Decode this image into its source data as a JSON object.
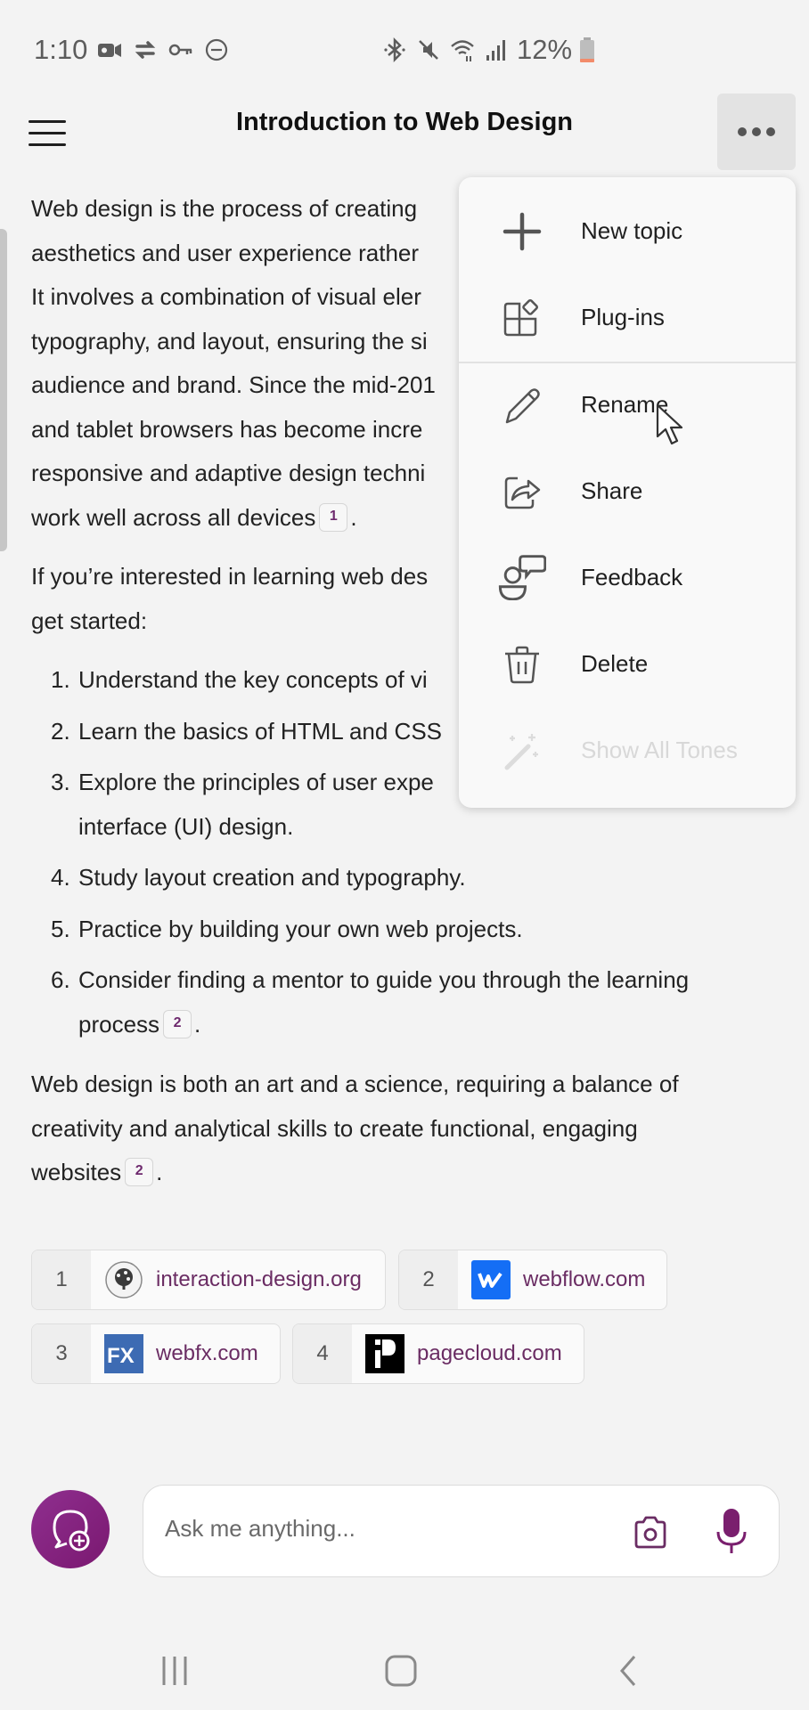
{
  "status_bar": {
    "time": "1:10",
    "left_icons": [
      "video-camera-icon",
      "sync-icon",
      "key-icon",
      "do-not-disturb-icon"
    ],
    "right_icons": [
      "bluetooth-icon",
      "mute-icon",
      "wifi-icon",
      "signal-icon"
    ],
    "battery_percent": "12%",
    "battery_level": 0.12,
    "battery_low_color": "#f28b6a"
  },
  "header": {
    "title": "Introduction to Web Design",
    "menu_icon": "hamburger-icon",
    "more_icon": "more-horizontal-icon"
  },
  "content": {
    "paragraph1": "Web design is the process of creating websites that focuses on aesthetics and user experience rather than software development. It involves a combination of visual elements such as color, imagery, typography, and layout, ensuring the site is well-suited to the audience and brand. Since the mid-2010s, the use of mobile and tablet browsers has become increasingly important, leading to responsive and adaptive design techniques that make websites work well across all devices",
    "p1_lines": [
      "Web design is the process of creating",
      "aesthetics and user experience rather",
      "It involves a combination of visual eler",
      "typography, and layout, ensuring the si",
      "audience and brand. Since the mid-201",
      "and tablet browsers has become incre",
      "responsive and adaptive design techni",
      "work well across all devices"
    ],
    "p1_cite": "1",
    "paragraph2_lines": [
      "If you’re interested in learning web des",
      "get started:"
    ],
    "list": [
      {
        "num": "1.",
        "text": "Understand the key concepts of vi"
      },
      {
        "num": "2.",
        "text": "Learn the basics of HTML and CSS"
      },
      {
        "num": "3.",
        "text": "Explore the principles of user expe",
        "text2": "interface (UI) design."
      },
      {
        "num": "4.",
        "text": "Study layout creation and typography."
      },
      {
        "num": "5.",
        "text": "Practice by building your own web projects."
      },
      {
        "num": "6.",
        "text": "Consider finding a mentor to guide you through the learning",
        "text2": "process",
        "cite": "2"
      }
    ],
    "paragraph3_lines": [
      "Web design is both an art and a science, requiring a balance of",
      "creativity and analytical skills to create functional, engaging",
      "websites"
    ],
    "p3_cite": "2",
    "period": "."
  },
  "sources": [
    {
      "num": "1",
      "label": "interaction-design.org",
      "logo": "interaction-design-tree-logo"
    },
    {
      "num": "2",
      "label": "webflow.com",
      "logo": "webflow-logo",
      "color": "#146ef5"
    },
    {
      "num": "3",
      "label": "webfx.com",
      "logo": "webfx-logo",
      "color": "#3d6bb3"
    },
    {
      "num": "4",
      "label": "pagecloud.com",
      "logo": "pagecloud-logo",
      "color": "#000000"
    }
  ],
  "menu": {
    "items": [
      {
        "label": "New topic",
        "icon": "plus-icon",
        "enabled": true
      },
      {
        "label": "Plug-ins",
        "icon": "plugins-icon",
        "enabled": true
      },
      {
        "label": "Rename",
        "icon": "pencil-icon",
        "enabled": true
      },
      {
        "label": "Share",
        "icon": "share-icon",
        "enabled": true
      },
      {
        "label": "Feedback",
        "icon": "feedback-icon",
        "enabled": true
      },
      {
        "label": "Delete",
        "icon": "trash-icon",
        "enabled": true
      },
      {
        "label": "Show All Tones",
        "icon": "magic-wand-icon",
        "enabled": false
      }
    ]
  },
  "input": {
    "placeholder": "Ask me anything...",
    "value": ""
  },
  "colors": {
    "accent": "#7d1f76",
    "link": "#6a2c63",
    "background": "#f3f3f3"
  }
}
